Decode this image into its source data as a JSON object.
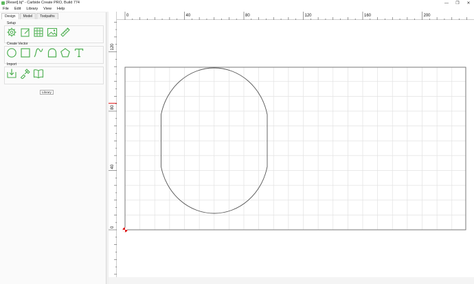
{
  "window": {
    "title": "[Reset].bj* - Carbide Create PRO, Build 774",
    "minimize": "—",
    "restore": "❐",
    "close": "✕"
  },
  "menu": [
    "File",
    "Edit",
    "Library",
    "View",
    "Help"
  ],
  "tabs": [
    "Design",
    "Model",
    "Toolpaths"
  ],
  "sections": {
    "setup": "Setup",
    "create_vector": "Create Vector",
    "import": "Import"
  },
  "setup_tools": [
    "settings-icon",
    "edit-icon",
    "grid-icon",
    "image-icon",
    "ruler-icon"
  ],
  "vector_tools": [
    "circle-icon",
    "rectangle-icon",
    "curve-icon",
    "polygon-icon",
    "pentagon-icon",
    "text-icon"
  ],
  "import_tools": [
    "import-icon",
    "tools-icon",
    "library-icon"
  ],
  "tooltip": "Library",
  "ruler": {
    "x_ticks": [
      "0",
      "40",
      "80",
      "120",
      "160",
      "200"
    ],
    "y_ticks": [
      "120",
      "80",
      "40",
      "0"
    ]
  },
  "colors": {
    "accent": "#4caf50",
    "origin": "#e02020",
    "grid": "#e2e2e2",
    "stock": "#777777"
  }
}
